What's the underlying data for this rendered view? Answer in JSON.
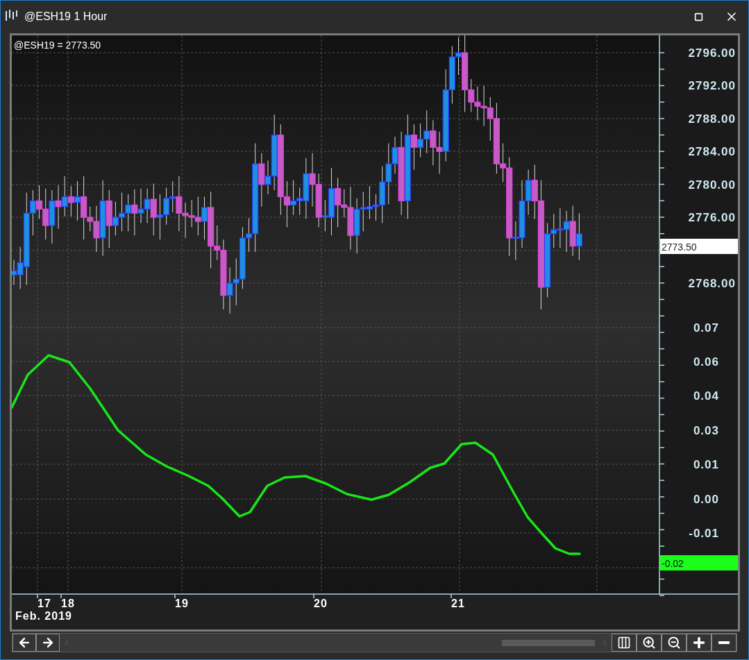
{
  "window": {
    "title": "@ESH19 1 Hour"
  },
  "chart": {
    "legend": "@ESH19 = 2773.50",
    "price_axis": [
      "2796.00",
      "2792.00",
      "2788.00",
      "2784.00",
      "2780.00",
      "2776.00",
      "2768.00"
    ],
    "current_price": "2773.50",
    "oscillator_axis": [
      "0.07",
      "0.06",
      "0.04",
      "0.03",
      "0.01",
      "0.00",
      "-0.01"
    ],
    "oscillator_value": "-0.02",
    "date_axis": [
      "17",
      "18",
      "19",
      "20",
      "21"
    ],
    "date_caption": "Feb. 2019"
  }
}
